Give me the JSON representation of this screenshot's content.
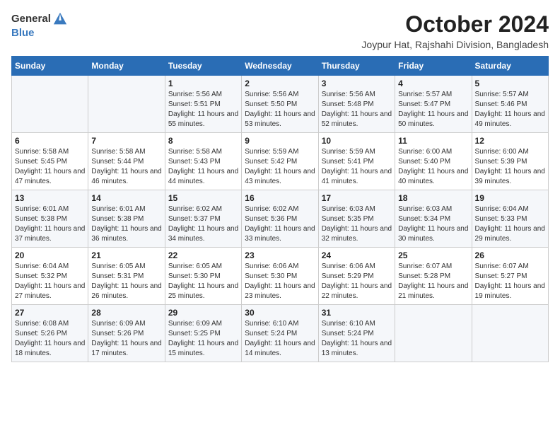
{
  "logo": {
    "general": "General",
    "blue": "Blue"
  },
  "title": "October 2024",
  "location": "Joypur Hat, Rajshahi Division, Bangladesh",
  "weekdays": [
    "Sunday",
    "Monday",
    "Tuesday",
    "Wednesday",
    "Thursday",
    "Friday",
    "Saturday"
  ],
  "weeks": [
    [
      {
        "day": "",
        "sunrise": "",
        "sunset": "",
        "daylight": ""
      },
      {
        "day": "",
        "sunrise": "",
        "sunset": "",
        "daylight": ""
      },
      {
        "day": "1",
        "sunrise": "Sunrise: 5:56 AM",
        "sunset": "Sunset: 5:51 PM",
        "daylight": "Daylight: 11 hours and 55 minutes."
      },
      {
        "day": "2",
        "sunrise": "Sunrise: 5:56 AM",
        "sunset": "Sunset: 5:50 PM",
        "daylight": "Daylight: 11 hours and 53 minutes."
      },
      {
        "day": "3",
        "sunrise": "Sunrise: 5:56 AM",
        "sunset": "Sunset: 5:48 PM",
        "daylight": "Daylight: 11 hours and 52 minutes."
      },
      {
        "day": "4",
        "sunrise": "Sunrise: 5:57 AM",
        "sunset": "Sunset: 5:47 PM",
        "daylight": "Daylight: 11 hours and 50 minutes."
      },
      {
        "day": "5",
        "sunrise": "Sunrise: 5:57 AM",
        "sunset": "Sunset: 5:46 PM",
        "daylight": "Daylight: 11 hours and 49 minutes."
      }
    ],
    [
      {
        "day": "6",
        "sunrise": "Sunrise: 5:58 AM",
        "sunset": "Sunset: 5:45 PM",
        "daylight": "Daylight: 11 hours and 47 minutes."
      },
      {
        "day": "7",
        "sunrise": "Sunrise: 5:58 AM",
        "sunset": "Sunset: 5:44 PM",
        "daylight": "Daylight: 11 hours and 46 minutes."
      },
      {
        "day": "8",
        "sunrise": "Sunrise: 5:58 AM",
        "sunset": "Sunset: 5:43 PM",
        "daylight": "Daylight: 11 hours and 44 minutes."
      },
      {
        "day": "9",
        "sunrise": "Sunrise: 5:59 AM",
        "sunset": "Sunset: 5:42 PM",
        "daylight": "Daylight: 11 hours and 43 minutes."
      },
      {
        "day": "10",
        "sunrise": "Sunrise: 5:59 AM",
        "sunset": "Sunset: 5:41 PM",
        "daylight": "Daylight: 11 hours and 41 minutes."
      },
      {
        "day": "11",
        "sunrise": "Sunrise: 6:00 AM",
        "sunset": "Sunset: 5:40 PM",
        "daylight": "Daylight: 11 hours and 40 minutes."
      },
      {
        "day": "12",
        "sunrise": "Sunrise: 6:00 AM",
        "sunset": "Sunset: 5:39 PM",
        "daylight": "Daylight: 11 hours and 39 minutes."
      }
    ],
    [
      {
        "day": "13",
        "sunrise": "Sunrise: 6:01 AM",
        "sunset": "Sunset: 5:38 PM",
        "daylight": "Daylight: 11 hours and 37 minutes."
      },
      {
        "day": "14",
        "sunrise": "Sunrise: 6:01 AM",
        "sunset": "Sunset: 5:38 PM",
        "daylight": "Daylight: 11 hours and 36 minutes."
      },
      {
        "day": "15",
        "sunrise": "Sunrise: 6:02 AM",
        "sunset": "Sunset: 5:37 PM",
        "daylight": "Daylight: 11 hours and 34 minutes."
      },
      {
        "day": "16",
        "sunrise": "Sunrise: 6:02 AM",
        "sunset": "Sunset: 5:36 PM",
        "daylight": "Daylight: 11 hours and 33 minutes."
      },
      {
        "day": "17",
        "sunrise": "Sunrise: 6:03 AM",
        "sunset": "Sunset: 5:35 PM",
        "daylight": "Daylight: 11 hours and 32 minutes."
      },
      {
        "day": "18",
        "sunrise": "Sunrise: 6:03 AM",
        "sunset": "Sunset: 5:34 PM",
        "daylight": "Daylight: 11 hours and 30 minutes."
      },
      {
        "day": "19",
        "sunrise": "Sunrise: 6:04 AM",
        "sunset": "Sunset: 5:33 PM",
        "daylight": "Daylight: 11 hours and 29 minutes."
      }
    ],
    [
      {
        "day": "20",
        "sunrise": "Sunrise: 6:04 AM",
        "sunset": "Sunset: 5:32 PM",
        "daylight": "Daylight: 11 hours and 27 minutes."
      },
      {
        "day": "21",
        "sunrise": "Sunrise: 6:05 AM",
        "sunset": "Sunset: 5:31 PM",
        "daylight": "Daylight: 11 hours and 26 minutes."
      },
      {
        "day": "22",
        "sunrise": "Sunrise: 6:05 AM",
        "sunset": "Sunset: 5:30 PM",
        "daylight": "Daylight: 11 hours and 25 minutes."
      },
      {
        "day": "23",
        "sunrise": "Sunrise: 6:06 AM",
        "sunset": "Sunset: 5:30 PM",
        "daylight": "Daylight: 11 hours and 23 minutes."
      },
      {
        "day": "24",
        "sunrise": "Sunrise: 6:06 AM",
        "sunset": "Sunset: 5:29 PM",
        "daylight": "Daylight: 11 hours and 22 minutes."
      },
      {
        "day": "25",
        "sunrise": "Sunrise: 6:07 AM",
        "sunset": "Sunset: 5:28 PM",
        "daylight": "Daylight: 11 hours and 21 minutes."
      },
      {
        "day": "26",
        "sunrise": "Sunrise: 6:07 AM",
        "sunset": "Sunset: 5:27 PM",
        "daylight": "Daylight: 11 hours and 19 minutes."
      }
    ],
    [
      {
        "day": "27",
        "sunrise": "Sunrise: 6:08 AM",
        "sunset": "Sunset: 5:26 PM",
        "daylight": "Daylight: 11 hours and 18 minutes."
      },
      {
        "day": "28",
        "sunrise": "Sunrise: 6:09 AM",
        "sunset": "Sunset: 5:26 PM",
        "daylight": "Daylight: 11 hours and 17 minutes."
      },
      {
        "day": "29",
        "sunrise": "Sunrise: 6:09 AM",
        "sunset": "Sunset: 5:25 PM",
        "daylight": "Daylight: 11 hours and 15 minutes."
      },
      {
        "day": "30",
        "sunrise": "Sunrise: 6:10 AM",
        "sunset": "Sunset: 5:24 PM",
        "daylight": "Daylight: 11 hours and 14 minutes."
      },
      {
        "day": "31",
        "sunrise": "Sunrise: 6:10 AM",
        "sunset": "Sunset: 5:24 PM",
        "daylight": "Daylight: 11 hours and 13 minutes."
      },
      {
        "day": "",
        "sunrise": "",
        "sunset": "",
        "daylight": ""
      },
      {
        "day": "",
        "sunrise": "",
        "sunset": "",
        "daylight": ""
      }
    ]
  ]
}
